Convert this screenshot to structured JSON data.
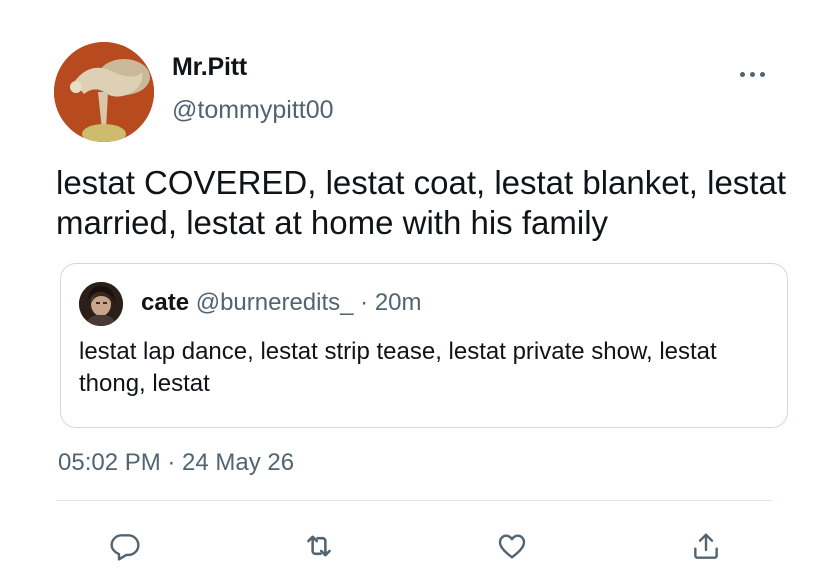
{
  "tweet": {
    "author": {
      "display_name": "Mr.Pitt",
      "handle": "@tommypitt00",
      "avatar_icon": "avatar-image"
    },
    "text": "lestat COVERED, lestat coat, lestat blanket, lestat married, lestat at home with his family",
    "quoted_tweet": {
      "author_name": "cate",
      "author_meta": "@burneredits_ · 20m",
      "text": "lestat lap dance, lestat strip tease, lestat private show, lestat thong, lestat"
    },
    "timestamp": "05:02 PM · 24 May 26",
    "actions": [
      "reply-icon",
      "retweet-icon",
      "like-icon",
      "share-icon"
    ],
    "colors": {
      "primary_text": "#0f1419",
      "secondary_text": "#536471",
      "border": "#cfd9de",
      "divider": "#e1e8ed"
    }
  }
}
